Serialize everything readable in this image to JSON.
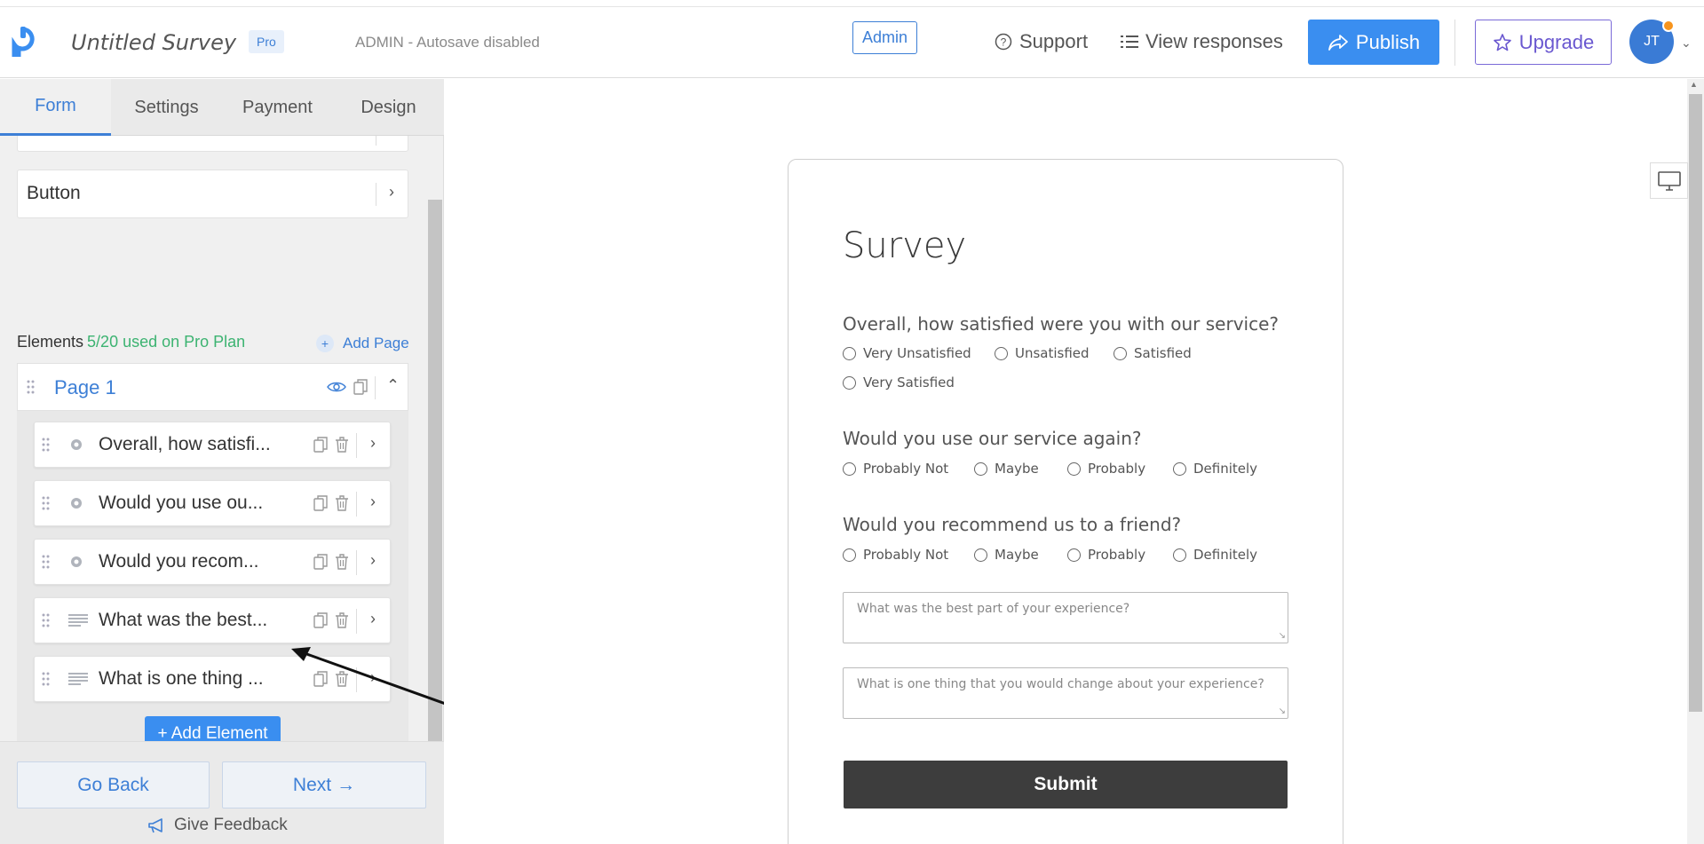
{
  "header": {
    "survey_title": "Untitled Survey",
    "pro_badge": "Pro",
    "autosave": "ADMIN - Autosave disabled",
    "admin_label": "Admin",
    "support_label": "Support",
    "view_responses_label": "View responses",
    "publish_label": "Publish",
    "upgrade_label": "Upgrade",
    "avatar_initials": "JT"
  },
  "sidebar": {
    "tabs": [
      {
        "label": "Form",
        "active": true
      },
      {
        "label": "Settings",
        "active": false
      },
      {
        "label": "Payment",
        "active": false
      },
      {
        "label": "Design",
        "active": false
      }
    ],
    "button_row_label": "Button",
    "elements_heading": "Elements",
    "elements_usage": "5/20 used on Pro Plan",
    "add_page_label": "Add Page",
    "page_label": "Page 1",
    "elements": [
      {
        "label": "Overall, how satisfi...",
        "type": "radio"
      },
      {
        "label": "Would you use ou...",
        "type": "radio"
      },
      {
        "label": "Would you recom...",
        "type": "radio"
      },
      {
        "label": "What was the best...",
        "type": "text"
      },
      {
        "label": "What is one thing ...",
        "type": "text"
      }
    ],
    "add_element_label": "+ Add Element",
    "go_back_label": "Go Back",
    "next_label": "Next",
    "feedback_label": "Give Feedback"
  },
  "form": {
    "title": "Survey",
    "questions": [
      {
        "title": "Overall, how satisfied were you with our service?",
        "options": [
          "Very Unsatisfied",
          "Unsatisfied",
          "Satisfied",
          "Very Satisfied"
        ]
      },
      {
        "title": "Would you use our service again?",
        "options": [
          "Probably Not",
          "Maybe",
          "Probably",
          "Definitely"
        ]
      },
      {
        "title": "Would you recommend us to a friend?",
        "options": [
          "Probably Not",
          "Maybe",
          "Probably",
          "Definitely"
        ]
      }
    ],
    "text_fields": [
      {
        "placeholder": "What was the best part of your experience?"
      },
      {
        "placeholder": "What is one thing that you would change about your experience?"
      }
    ],
    "submit_label": "Submit"
  },
  "colors": {
    "accent": "#3a8ef0",
    "upgrade": "#6a58d0",
    "usage_green": "#3cb371",
    "submit_bg": "#3d3d3d"
  }
}
